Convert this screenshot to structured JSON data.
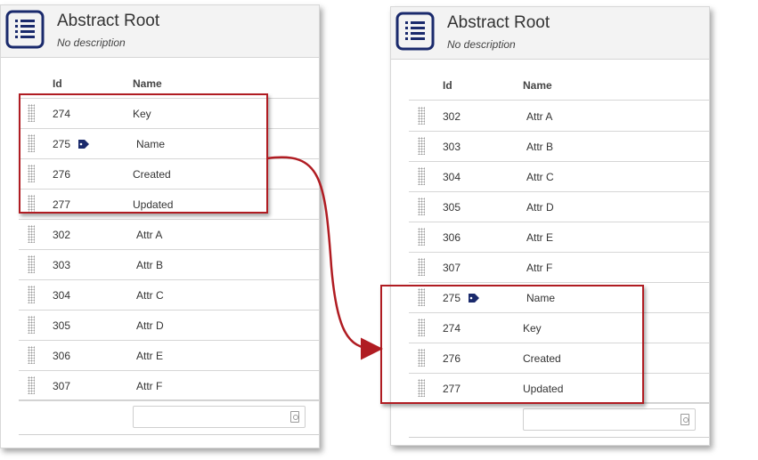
{
  "colors": {
    "accent": "#1a2a6c",
    "highlight": "#b01c22",
    "header_bg": "#f3f3f3"
  },
  "left": {
    "title": "Abstract Root",
    "subtitle": "No description",
    "columns": {
      "id": "Id",
      "name": "Name"
    },
    "rows": [
      {
        "id": "274",
        "name": "Key",
        "tag": false
      },
      {
        "id": "275",
        "name": "Name",
        "tag": true
      },
      {
        "id": "276",
        "name": "Created",
        "tag": false
      },
      {
        "id": "277",
        "name": "Updated",
        "tag": false
      },
      {
        "id": "302",
        "name": "Attr A",
        "tag": false
      },
      {
        "id": "303",
        "name": "Attr B",
        "tag": false
      },
      {
        "id": "304",
        "name": "Attr C",
        "tag": false
      },
      {
        "id": "305",
        "name": "Attr D",
        "tag": false
      },
      {
        "id": "306",
        "name": "Attr E",
        "tag": false
      },
      {
        "id": "307",
        "name": "Attr F",
        "tag": false
      }
    ],
    "search_placeholder": ""
  },
  "right": {
    "title": "Abstract Root",
    "subtitle": "No description",
    "columns": {
      "id": "Id",
      "name": "Name"
    },
    "rows": [
      {
        "id": "302",
        "name": "Attr A",
        "tag": false
      },
      {
        "id": "303",
        "name": "Attr B",
        "tag": false
      },
      {
        "id": "304",
        "name": "Attr C",
        "tag": false
      },
      {
        "id": "305",
        "name": "Attr D",
        "tag": false
      },
      {
        "id": "306",
        "name": "Attr E",
        "tag": false
      },
      {
        "id": "307",
        "name": "Attr F",
        "tag": false
      },
      {
        "id": "275",
        "name": "Name",
        "tag": true
      },
      {
        "id": "274",
        "name": "Key",
        "tag": false
      },
      {
        "id": "276",
        "name": "Created",
        "tag": false
      },
      {
        "id": "277",
        "name": "Updated",
        "tag": false
      }
    ],
    "search_placeholder": ""
  },
  "icons": {
    "header": "entity-table-icon",
    "tag": "tag-icon",
    "search": "search-field-icon",
    "drag": "drag-handle-icon"
  }
}
